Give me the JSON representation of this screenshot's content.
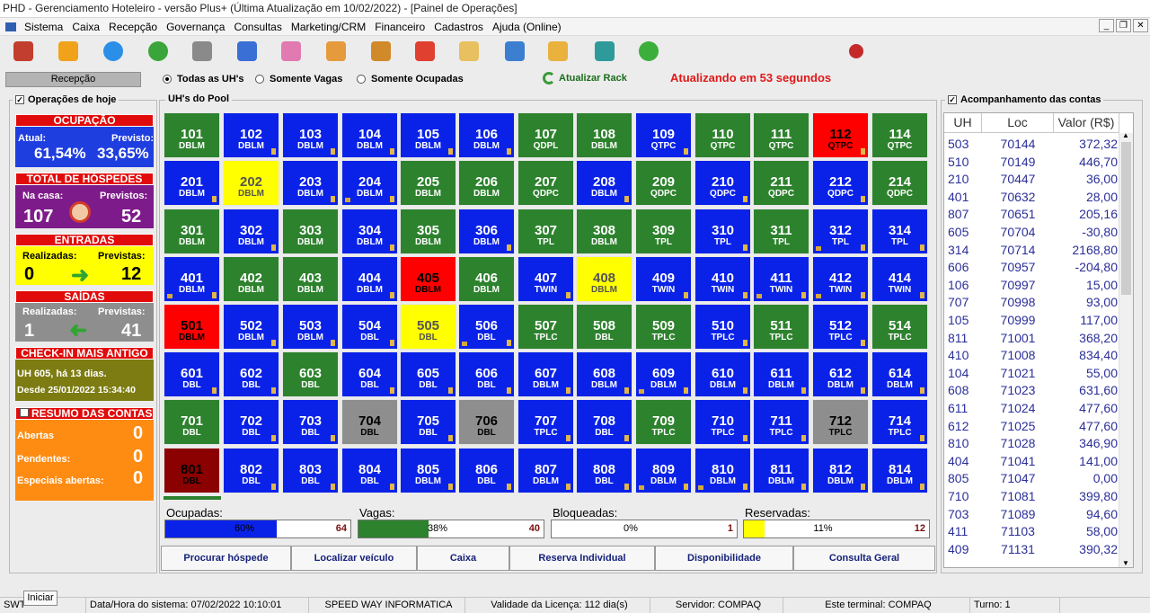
{
  "window": {
    "title": "PHD - Gerenciamento Hoteleiro - versão Plus+     (Última Atualização em 10/02/2022) - [Painel de Operações]"
  },
  "menu": [
    "Sistema",
    "Caixa",
    "Recepção",
    "Governança",
    "Consultas",
    "Marketing/CRM",
    "Financeiro",
    "Cadastros",
    "Ajuda (Online)"
  ],
  "toolbar_icons": [
    "exit-icon",
    "lock-icon",
    "chat-icon",
    "timer-12-icon",
    "network-icon",
    "card-icon",
    "bed-icon",
    "family-icon",
    "group-icon",
    "walker-icon",
    "user-icon",
    "document-search-icon",
    "receipt-icon",
    "grid-icon",
    "money-icon",
    "target-icon"
  ],
  "reception_label": "Recepção",
  "filter": {
    "all": "Todas as UH's",
    "vacant": "Somente Vagas",
    "occupied": "Somente Ocupadas"
  },
  "refresh_label": "Atualizar Rack",
  "countdown": "Atualizando em 53 segundos",
  "ops": {
    "title": "Operações de hoje",
    "occupancy": {
      "title": "OCUPAÇÃO",
      "current_label": "Atual:",
      "forecast_label": "Previsto:",
      "current": "61,54%",
      "forecast": "33,65%"
    },
    "guests": {
      "title": "TOTAL DE HÓSPEDES",
      "home_label": "Na casa:",
      "forecast_label": "Previstos:",
      "home": "107",
      "forecast": "52"
    },
    "arrivals": {
      "title": "ENTRADAS",
      "done_label": "Realizadas:",
      "forecast_label": "Previstas:",
      "done": "0",
      "forecast": "12"
    },
    "departures": {
      "title": "SAÍDAS",
      "done_label": "Realizadas:",
      "forecast_label": "Previstas:",
      "done": "1",
      "forecast": "41"
    },
    "oldest": {
      "title": "CHECK-IN MAIS ANTIGO",
      "line1": "UH 605, há 13 dias.",
      "line2": "Desde 25/01/2022 15:34:40"
    },
    "accounts": {
      "title": "RESUMO DAS CONTAS",
      "open_label": "Abertas",
      "pending_label": "Pendentes:",
      "special_label": "Especiais abertas:",
      "open": "0",
      "pending": "0",
      "special": "0"
    }
  },
  "pool": {
    "title": "UH's do Pool"
  },
  "colors": {
    "occupied": "#2d822d",
    "vacant": "#0a22e8",
    "dirty": "#ff0000",
    "arriving": "#ffff00",
    "blocked": "#8e8e8e",
    "maintenance": "#8b0000"
  },
  "rooms": [
    [
      {
        "n": "101",
        "t": "DBLM",
        "s": "occupied"
      },
      {
        "n": "102",
        "t": "DBLM",
        "s": "vacant",
        "f": 1
      },
      {
        "n": "103",
        "t": "DBLM",
        "s": "vacant",
        "f": 1
      },
      {
        "n": "104",
        "t": "DBLM",
        "s": "vacant",
        "f": 1
      },
      {
        "n": "105",
        "t": "DBLM",
        "s": "vacant",
        "f": 1
      },
      {
        "n": "106",
        "t": "DBLM",
        "s": "vacant",
        "f": 1
      },
      {
        "n": "107",
        "t": "QDPL",
        "s": "occupied"
      },
      {
        "n": "108",
        "t": "DBLM",
        "s": "occupied"
      },
      {
        "n": "109",
        "t": "QTPC",
        "s": "vacant",
        "f": 1
      },
      {
        "n": "110",
        "t": "QTPC",
        "s": "occupied"
      },
      {
        "n": "111",
        "t": "QTPC",
        "s": "occupied"
      },
      {
        "n": "112",
        "t": "QTPC",
        "s": "dirty",
        "f": 1
      },
      {
        "n": "114",
        "t": "QTPC",
        "s": "occupied"
      }
    ],
    [
      {
        "n": "201",
        "t": "DBLM",
        "s": "vacant",
        "f": 1
      },
      {
        "n": "202",
        "t": "DBLM",
        "s": "arriving"
      },
      {
        "n": "203",
        "t": "DBLM",
        "s": "vacant",
        "f": 1
      },
      {
        "n": "204",
        "t": "DBLM",
        "s": "vacant",
        "f": 1,
        "k": 1
      },
      {
        "n": "205",
        "t": "DBLM",
        "s": "occupied"
      },
      {
        "n": "206",
        "t": "DBLM",
        "s": "occupied"
      },
      {
        "n": "207",
        "t": "QDPC",
        "s": "occupied"
      },
      {
        "n": "208",
        "t": "DBLM",
        "s": "vacant",
        "f": 1
      },
      {
        "n": "209",
        "t": "QDPC",
        "s": "occupied"
      },
      {
        "n": "210",
        "t": "QDPC",
        "s": "vacant",
        "f": 1
      },
      {
        "n": "211",
        "t": "QDPC",
        "s": "occupied"
      },
      {
        "n": "212",
        "t": "QDPC",
        "s": "vacant",
        "f": 1
      },
      {
        "n": "214",
        "t": "QDPC",
        "s": "occupied"
      }
    ],
    [
      {
        "n": "301",
        "t": "DBLM",
        "s": "occupied"
      },
      {
        "n": "302",
        "t": "DBLM",
        "s": "vacant",
        "f": 1
      },
      {
        "n": "303",
        "t": "DBLM",
        "s": "occupied"
      },
      {
        "n": "304",
        "t": "DBLM",
        "s": "vacant",
        "f": 1
      },
      {
        "n": "305",
        "t": "DBLM",
        "s": "occupied"
      },
      {
        "n": "306",
        "t": "DBLM",
        "s": "vacant",
        "f": 1
      },
      {
        "n": "307",
        "t": "TPL",
        "s": "occupied"
      },
      {
        "n": "308",
        "t": "DBLM",
        "s": "occupied"
      },
      {
        "n": "309",
        "t": "TPL",
        "s": "occupied"
      },
      {
        "n": "310",
        "t": "TPL",
        "s": "vacant",
        "f": 1
      },
      {
        "n": "311",
        "t": "TPL",
        "s": "occupied"
      },
      {
        "n": "312",
        "t": "TPL",
        "s": "vacant",
        "f": 1,
        "k": 1
      },
      {
        "n": "314",
        "t": "TPL",
        "s": "vacant",
        "f": 1
      }
    ],
    [
      {
        "n": "401",
        "t": "DBLM",
        "s": "vacant",
        "f": 1,
        "k": 1
      },
      {
        "n": "402",
        "t": "DBLM",
        "s": "occupied"
      },
      {
        "n": "403",
        "t": "DBLM",
        "s": "occupied"
      },
      {
        "n": "404",
        "t": "DBLM",
        "s": "vacant",
        "f": 1
      },
      {
        "n": "405",
        "t": "DBLM",
        "s": "dirty"
      },
      {
        "n": "406",
        "t": "DBLM",
        "s": "occupied"
      },
      {
        "n": "407",
        "t": "TWIN",
        "s": "vacant",
        "f": 1
      },
      {
        "n": "408",
        "t": "DBLM",
        "s": "arriving"
      },
      {
        "n": "409",
        "t": "TWIN",
        "s": "vacant",
        "f": 1
      },
      {
        "n": "410",
        "t": "TWIN",
        "s": "vacant",
        "f": 1
      },
      {
        "n": "411",
        "t": "TWIN",
        "s": "vacant",
        "f": 1,
        "k": 1
      },
      {
        "n": "412",
        "t": "TWIN",
        "s": "vacant",
        "f": 1,
        "k": 1
      },
      {
        "n": "414",
        "t": "TWIN",
        "s": "vacant",
        "f": 1
      }
    ],
    [
      {
        "n": "501",
        "t": "DBLM",
        "s": "dirty"
      },
      {
        "n": "502",
        "t": "DBLM",
        "s": "vacant",
        "f": 1
      },
      {
        "n": "503",
        "t": "DBLM",
        "s": "vacant",
        "f": 1
      },
      {
        "n": "504",
        "t": "DBL",
        "s": "vacant",
        "f": 1
      },
      {
        "n": "505",
        "t": "DBL",
        "s": "arriving"
      },
      {
        "n": "506",
        "t": "DBL",
        "s": "vacant",
        "f": 1,
        "k": 1
      },
      {
        "n": "507",
        "t": "TPLC",
        "s": "occupied"
      },
      {
        "n": "508",
        "t": "DBL",
        "s": "occupied"
      },
      {
        "n": "509",
        "t": "TPLC",
        "s": "occupied"
      },
      {
        "n": "510",
        "t": "TPLC",
        "s": "vacant",
        "f": 1
      },
      {
        "n": "511",
        "t": "TPLC",
        "s": "occupied"
      },
      {
        "n": "512",
        "t": "TPLC",
        "s": "vacant",
        "f": 1
      },
      {
        "n": "514",
        "t": "TPLC",
        "s": "occupied"
      }
    ],
    [
      {
        "n": "601",
        "t": "DBL",
        "s": "vacant",
        "f": 1
      },
      {
        "n": "602",
        "t": "DBL",
        "s": "vacant",
        "f": 1
      },
      {
        "n": "603",
        "t": "DBL",
        "s": "occupied"
      },
      {
        "n": "604",
        "t": "DBL",
        "s": "vacant",
        "f": 1
      },
      {
        "n": "605",
        "t": "DBL",
        "s": "vacant",
        "f": 1
      },
      {
        "n": "606",
        "t": "DBL",
        "s": "vacant",
        "f": 1
      },
      {
        "n": "607",
        "t": "DBLM",
        "s": "vacant",
        "f": 1
      },
      {
        "n": "608",
        "t": "DBLM",
        "s": "vacant",
        "f": 1
      },
      {
        "n": "609",
        "t": "DBLM",
        "s": "vacant",
        "f": 1,
        "k": 1
      },
      {
        "n": "610",
        "t": "DBLM",
        "s": "vacant",
        "f": 1
      },
      {
        "n": "611",
        "t": "DBLM",
        "s": "vacant",
        "f": 1
      },
      {
        "n": "612",
        "t": "DBLM",
        "s": "vacant",
        "f": 1
      },
      {
        "n": "614",
        "t": "DBLM",
        "s": "vacant",
        "f": 1
      }
    ],
    [
      {
        "n": "701",
        "t": "DBL",
        "s": "occupied"
      },
      {
        "n": "702",
        "t": "DBL",
        "s": "vacant",
        "f": 1
      },
      {
        "n": "703",
        "t": "DBL",
        "s": "vacant",
        "f": 1
      },
      {
        "n": "704",
        "t": "DBL",
        "s": "blocked"
      },
      {
        "n": "705",
        "t": "DBL",
        "s": "vacant",
        "f": 1
      },
      {
        "n": "706",
        "t": "DBL",
        "s": "blocked"
      },
      {
        "n": "707",
        "t": "TPLC",
        "s": "vacant",
        "f": 1
      },
      {
        "n": "708",
        "t": "DBL",
        "s": "vacant",
        "f": 1
      },
      {
        "n": "709",
        "t": "TPLC",
        "s": "occupied"
      },
      {
        "n": "710",
        "t": "TPLC",
        "s": "vacant",
        "f": 1
      },
      {
        "n": "711",
        "t": "TPLC",
        "s": "vacant",
        "f": 1
      },
      {
        "n": "712",
        "t": "TPLC",
        "s": "blocked"
      },
      {
        "n": "714",
        "t": "TPLC",
        "s": "vacant",
        "f": 1
      }
    ],
    [
      {
        "n": "801",
        "t": "DBL",
        "s": "maintenance"
      },
      {
        "n": "802",
        "t": "DBL",
        "s": "vacant",
        "f": 1
      },
      {
        "n": "803",
        "t": "DBL",
        "s": "vacant",
        "f": 1
      },
      {
        "n": "804",
        "t": "DBL",
        "s": "vacant",
        "f": 1
      },
      {
        "n": "805",
        "t": "DBLM",
        "s": "vacant",
        "f": 1
      },
      {
        "n": "806",
        "t": "DBL",
        "s": "vacant",
        "f": 1
      },
      {
        "n": "807",
        "t": "DBLM",
        "s": "vacant",
        "f": 1
      },
      {
        "n": "808",
        "t": "DBL",
        "s": "vacant",
        "f": 1
      },
      {
        "n": "809",
        "t": "DBLM",
        "s": "vacant",
        "f": 1,
        "k": 1
      },
      {
        "n": "810",
        "t": "DBLM",
        "s": "vacant",
        "f": 1,
        "k": 1
      },
      {
        "n": "811",
        "t": "DBLM",
        "s": "vacant",
        "f": 1
      },
      {
        "n": "812",
        "t": "DBLM",
        "s": "vacant",
        "f": 1
      },
      {
        "n": "814",
        "t": "DBLM",
        "s": "vacant",
        "f": 1
      }
    ]
  ],
  "bars": [
    {
      "label": "Ocupadas:",
      "pct": "60%",
      "value": 0.6,
      "count": "64",
      "color": "#0a22e8"
    },
    {
      "label": "Vagas:",
      "pct": "38%",
      "value": 0.38,
      "count": "40",
      "color": "#2d822d"
    },
    {
      "label": "Bloqueadas:",
      "pct": "0%",
      "value": 0,
      "count": "1",
      "color": "#8e8e8e"
    },
    {
      "label": "Reservadas:",
      "pct": "11%",
      "value": 0.11,
      "count": "12",
      "color": "#ffff00"
    }
  ],
  "buttons": [
    "Procurar hóspede",
    "Localizar veículo",
    "Caixa",
    "Reserva Individual",
    "Disponibilidade",
    "Consulta Geral"
  ],
  "accounts_panel": {
    "title": "Acompanhamento das contas",
    "headers": [
      "UH",
      "Loc",
      "Valor (R$)"
    ],
    "rows": [
      [
        "503",
        "70144",
        "372,32"
      ],
      [
        "510",
        "70149",
        "446,70"
      ],
      [
        "210",
        "70447",
        "36,00"
      ],
      [
        "401",
        "70632",
        "28,00"
      ],
      [
        "807",
        "70651",
        "205,16"
      ],
      [
        "605",
        "70704",
        "-30,80"
      ],
      [
        "314",
        "70714",
        "2168,80"
      ],
      [
        "606",
        "70957",
        "-204,80"
      ],
      [
        "106",
        "70997",
        "15,00"
      ],
      [
        "707",
        "70998",
        "93,00"
      ],
      [
        "105",
        "70999",
        "117,00"
      ],
      [
        "811",
        "71001",
        "368,20"
      ],
      [
        "410",
        "71008",
        "834,40"
      ],
      [
        "104",
        "71021",
        "55,00"
      ],
      [
        "608",
        "71023",
        "631,60"
      ],
      [
        "611",
        "71024",
        "477,60"
      ],
      [
        "612",
        "71025",
        "477,60"
      ],
      [
        "810",
        "71028",
        "346,90"
      ],
      [
        "404",
        "71041",
        "141,00"
      ],
      [
        "805",
        "71047",
        "0,00"
      ],
      [
        "710",
        "71081",
        "399,80"
      ],
      [
        "703",
        "71089",
        "94,60"
      ],
      [
        "411",
        "71103",
        "58,00"
      ],
      [
        "409",
        "71131",
        "390,32"
      ]
    ]
  },
  "status": {
    "start": "Iniciar",
    "user": "SWT",
    "datetime": "Data/Hora do sistema: 07/02/2022 10:10:01",
    "company": "SPEED WAY INFORMATICA",
    "license": "Validade da Licença: 112 dia(s)",
    "server": "Servidor: COMPAQ",
    "terminal": "Este terminal: COMPAQ",
    "shift": "Turno: 1"
  }
}
